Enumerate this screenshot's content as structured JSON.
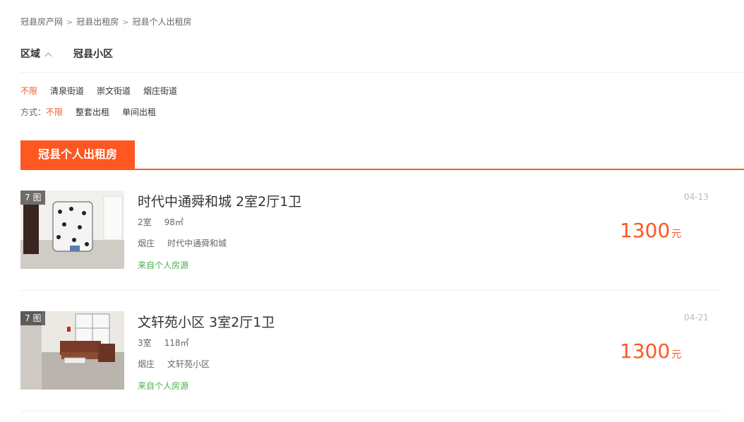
{
  "breadcrumb": [
    "冠县房产网",
    "冠县出租房",
    "冠县个人出租房"
  ],
  "filter_tabs": {
    "area": "区域",
    "community": "冠县小区"
  },
  "area_options": [
    "不限",
    "清泉街道",
    "崇文街道",
    "烟庄街道"
  ],
  "mode": {
    "label": "方式：",
    "options": [
      "不限",
      "整套出租",
      "单间出租"
    ]
  },
  "section_title": "冠县个人出租房",
  "listings": [
    {
      "photo_count": "7 图",
      "title": "时代中通舜和城 2室2厅1卫",
      "rooms": "2室",
      "area": "98㎡",
      "district": "烟庄",
      "community": "时代中通舜和城",
      "source": "来自个人房源",
      "date": "04-13",
      "price": "1300",
      "unit": "元"
    },
    {
      "photo_count": "7 图",
      "title": "文轩苑小区 3室2厅1卫",
      "rooms": "3室",
      "area": "118㎡",
      "district": "烟庄",
      "community": "文轩苑小区",
      "source": "来自个人房源",
      "date": "04-21",
      "price": "1300",
      "unit": "元"
    }
  ],
  "colors": {
    "accent": "#ff5722",
    "source_green": "#4caf50"
  }
}
